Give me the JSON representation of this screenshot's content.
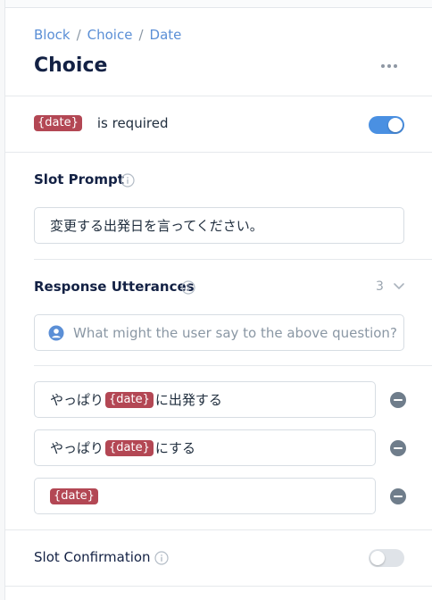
{
  "breadcrumb": {
    "items": [
      "Block",
      "Choice",
      "Date"
    ],
    "separator": "/"
  },
  "header": {
    "title": "Choice"
  },
  "required": {
    "slot": "{date}",
    "text": "is required",
    "enabled": true
  },
  "slot_prompt": {
    "label": "Slot Prompt",
    "value": "変更する出発日を言ってください。"
  },
  "utterances": {
    "label": "Response Utterances",
    "count": "3",
    "placeholder": "What might the user say to the above question?",
    "items": [
      {
        "before": "やっぱり",
        "slot": "{date}",
        "after": "に出発する"
      },
      {
        "before": "やっぱり",
        "slot": "{date}",
        "after": "にする"
      },
      {
        "before": "",
        "slot": "{date}",
        "after": ""
      }
    ]
  },
  "slot_confirmation": {
    "label": "Slot Confirmation",
    "enabled": false
  },
  "colors": {
    "accent": "#4a90e2",
    "slot_tag": "#b34754",
    "link": "#5b8fd6"
  }
}
